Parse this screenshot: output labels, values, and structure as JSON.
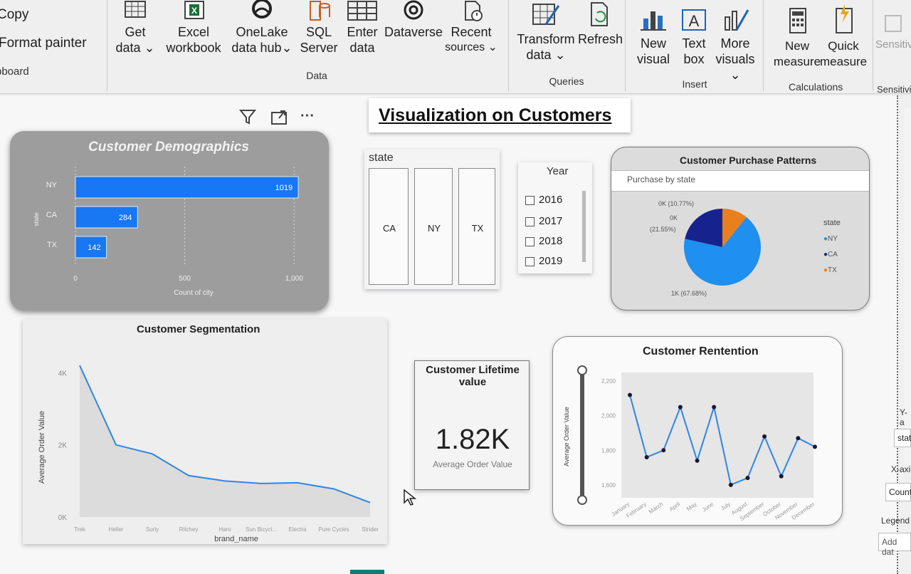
{
  "ribbon": {
    "clipboard": {
      "copy": "Copy",
      "format_painter": "Format painter",
      "label": "pboard"
    },
    "data": {
      "get_data": [
        "Get",
        "data ⌄"
      ],
      "excel": [
        "Excel",
        "workbook"
      ],
      "onelake": [
        "OneLake",
        "data hub⌄"
      ],
      "sql": [
        "SQL",
        "Server"
      ],
      "enter": [
        "Enter",
        "data"
      ],
      "dataverse": "Dataverse",
      "recent": [
        "Recent",
        "sources ⌄"
      ],
      "label": "Data"
    },
    "queries": {
      "transform": [
        "Transform",
        "data ⌄"
      ],
      "refresh": "Refresh",
      "label": "Queries"
    },
    "insert": {
      "new_visual": [
        "New",
        "visual"
      ],
      "text_box": [
        "Text",
        "box"
      ],
      "more": [
        "More",
        "visuals ⌄"
      ],
      "label": "Insert"
    },
    "calculations": {
      "new_measure": [
        "New",
        "measure"
      ],
      "quick_measure": [
        "Quick",
        "measure"
      ],
      "label": "Calculations"
    },
    "sensitivity": {
      "btn": "Sensitiv",
      "label": "Sensitivity"
    }
  },
  "report": {
    "title": "Visualization on Customers",
    "visual_header": {
      "filter": "filter-icon",
      "focus": "focus-mode-icon",
      "more": "···"
    },
    "demographics": {
      "title": "Customer Demographics",
      "y_axis": "state",
      "x_axis": "Count of city",
      "ticks": [
        "0",
        "500",
        "1,000"
      ]
    },
    "state_slicer": {
      "title": "state",
      "options": [
        "CA",
        "NY",
        "TX"
      ]
    },
    "year_slicer": {
      "title": "Year",
      "options": [
        "2016",
        "2017",
        "2018",
        "2019"
      ]
    },
    "purchase": {
      "title": "Customer Purchase Patterns",
      "subtitle": "Purchase by state",
      "legend_title": "state",
      "label_tx": "0K (10.77%)",
      "label_ca": [
        "0K",
        "(21.55%)"
      ],
      "label_ny": "1K (67.68%)"
    },
    "segmentation": {
      "title": "Customer Segmentation",
      "y_axis": "Average Order Value",
      "x_axis": "brand_name",
      "yticks": [
        "4K",
        "2K",
        "0K"
      ]
    },
    "lifetime": {
      "title": "Customer Lifetime value",
      "value": "1.82K",
      "caption": "Average Order Value"
    },
    "retention": {
      "title": "Customer Rentention",
      "y_axis": "Average Order Value",
      "yticks": [
        "2,200",
        "2,000",
        "1,800",
        "1,600"
      ]
    }
  },
  "pane": {
    "y_axis": "Y-a",
    "stat": "stat",
    "x_axis": "X-axi",
    "count": "Count",
    "legend": "Legend",
    "add": "Add dat"
  },
  "colors": {
    "ny": "#1f8ff0",
    "ca": "#16238f",
    "tx": "#e8801d",
    "bar": "#1877f2",
    "line": "#2f86e6"
  },
  "chart_data": [
    {
      "type": "bar",
      "title": "Customer Demographics",
      "categories": [
        "NY",
        "CA",
        "TX"
      ],
      "values": [
        1019,
        284,
        142
      ],
      "xlabel": "Count of city",
      "ylabel": "state",
      "xlim": [
        0,
        1100
      ]
    },
    {
      "type": "pie",
      "title": "Customer Purchase Patterns",
      "categories": [
        "NY",
        "CA",
        "TX"
      ],
      "values": [
        67.68,
        21.55,
        10.77
      ]
    },
    {
      "type": "area",
      "title": "Customer Segmentation",
      "categories": [
        "Trek",
        "Heller",
        "Surly",
        "Ritchey",
        "Haro",
        "Sun Bicycl...",
        "Electra",
        "Pure Cycles",
        "Strider"
      ],
      "values": [
        4200,
        2000,
        1750,
        1150,
        1000,
        930,
        950,
        780,
        400
      ],
      "xlabel": "brand_name",
      "ylabel": "Average Order Value",
      "ylim": [
        0,
        4500
      ]
    },
    {
      "type": "line",
      "title": "Customer Rentention",
      "categories": [
        "January",
        "February",
        "March",
        "April",
        "May",
        "June",
        "July",
        "August",
        "September",
        "October",
        "November",
        "December"
      ],
      "values": [
        2120,
        1760,
        1800,
        2050,
        1740,
        2050,
        1600,
        1640,
        1880,
        1650,
        1870,
        1820
      ],
      "ylabel": "Average Order Value",
      "ylim": [
        1550,
        2250
      ]
    }
  ]
}
